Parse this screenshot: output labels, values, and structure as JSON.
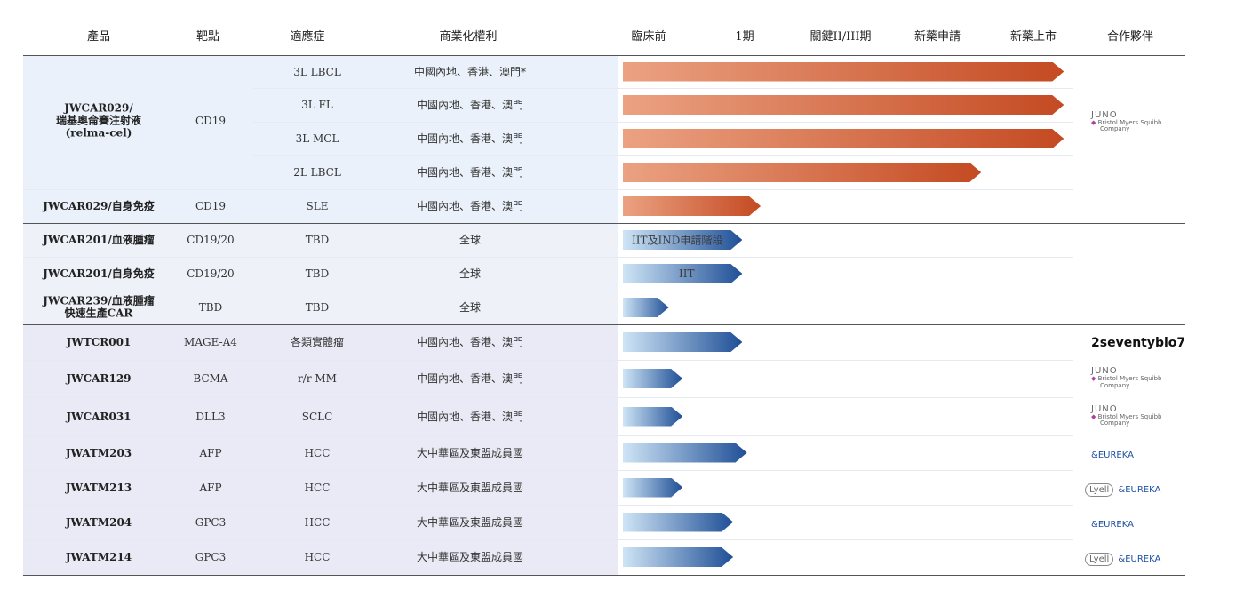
{
  "headers": {
    "product": "產品",
    "target": "靶點",
    "indication": "適應症",
    "rights": "商業化權利",
    "preclinical": "臨床前",
    "phase1": "1期",
    "pivotal": "關鍵II/III期",
    "nda": "新藥申請",
    "launch": "新藥上市",
    "partner": "合作夥伴"
  },
  "groups": [
    {
      "product": "JWCAR029/\n瑞基奧侖賽注射液\n(relma-cel)",
      "target": "CD19"
    }
  ],
  "rows": [
    {
      "product": "",
      "target": "",
      "indication": "3L LBCL",
      "rights": "中國內地、香港、澳門*"
    },
    {
      "product": "",
      "target": "",
      "indication": "3L FL",
      "rights": "中國內地、香港、澳門"
    },
    {
      "product": "",
      "target": "",
      "indication": "3L MCL",
      "rights": "中國內地、香港、澳門"
    },
    {
      "product": "",
      "target": "",
      "indication": "2L LBCL",
      "rights": "中國內地、香港、澳門"
    },
    {
      "product": "JWCAR029/自身免疫",
      "target": "CD19",
      "indication": "SLE",
      "rights": "中國內地、香港、澳門"
    },
    {
      "product": "JWCAR201/血液腫瘤",
      "target": "CD19/20",
      "indication": "TBD",
      "rights": "全球"
    },
    {
      "product": "JWCAR201/自身免疫",
      "target": "CD19/20",
      "indication": "TBD",
      "rights": "全球"
    },
    {
      "product": "JWCAR239/血液腫瘤\n快速生產CAR",
      "target": "TBD",
      "indication": "TBD",
      "rights": "全球"
    },
    {
      "product": "JWTCR001",
      "target": "MAGE-A4",
      "indication": "各類實體瘤",
      "rights": "中國內地、香港、澳門"
    },
    {
      "product": "JWCAR129",
      "target": "BCMA",
      "indication": "r/r MM",
      "rights": "中國內地、香港、澳門"
    },
    {
      "product": "JWCAR031",
      "target": "DLL3",
      "indication": "SCLC",
      "rights": "中國內地、香港、澳門"
    },
    {
      "product": "JWATM203",
      "target": "AFP",
      "indication": "HCC",
      "rights": "大中華區及東盟成員國"
    },
    {
      "product": "JWATM213",
      "target": "AFP",
      "indication": "HCC",
      "rights": "大中華區及東盟成員國"
    },
    {
      "product": "JWATM204",
      "target": "GPC3",
      "indication": "HCC",
      "rights": "大中華區及東盟成員國"
    },
    {
      "product": "JWATM214",
      "target": "GPC3",
      "indication": "HCC",
      "rights": "大中華區及東盟成員國"
    }
  ],
  "chart_data": {
    "type": "bar",
    "orientation": "horizontal",
    "stages": [
      "臨床前",
      "1期",
      "關鍵II/III期",
      "新藥申請",
      "新藥上市"
    ],
    "progress_unit": "stage columns reached (0 = start of 臨床前, 5 = end of 新藥上市)",
    "bars": [
      {
        "indication": "3L LBCL",
        "progress": 4.8,
        "color": "orange",
        "label": ""
      },
      {
        "indication": "3L FL",
        "progress": 4.8,
        "color": "orange",
        "label": ""
      },
      {
        "indication": "3L MCL",
        "progress": 4.8,
        "color": "orange",
        "label": ""
      },
      {
        "indication": "2L LBCL",
        "progress": 3.9,
        "color": "orange",
        "label": ""
      },
      {
        "indication": "SLE",
        "progress": 1.5,
        "color": "orange",
        "label": ""
      },
      {
        "indication": "TBD",
        "progress": 1.3,
        "color": "blue",
        "label": "IIT及IND申請階段"
      },
      {
        "indication": "TBD",
        "progress": 1.3,
        "color": "blue",
        "label": "IIT"
      },
      {
        "indication": "TBD",
        "progress": 0.5,
        "color": "blue",
        "label": ""
      },
      {
        "indication": "各類實體瘤",
        "progress": 1.3,
        "color": "blue",
        "label": ""
      },
      {
        "indication": "r/r MM",
        "progress": 0.65,
        "color": "blue",
        "label": ""
      },
      {
        "indication": "SCLC",
        "progress": 0.65,
        "color": "blue",
        "label": ""
      },
      {
        "indication": "HCC",
        "progress": 1.35,
        "color": "blue",
        "label": ""
      },
      {
        "indication": "HCC",
        "progress": 0.65,
        "color": "blue",
        "label": ""
      },
      {
        "indication": "HCC",
        "progress": 1.2,
        "color": "blue",
        "label": ""
      },
      {
        "indication": "HCC",
        "progress": 1.2,
        "color": "blue",
        "label": ""
      }
    ]
  },
  "partners": [
    {
      "rows": [
        0,
        3
      ],
      "kind": "juno-bms",
      "juno": "JUNO",
      "bms": "Bristol Myers Squibb",
      "bms_sub": "Company"
    },
    {
      "rows": [
        8
      ],
      "kind": "2seventy",
      "text": "2seventybio",
      "sup": "7"
    },
    {
      "rows": [
        9
      ],
      "kind": "juno-bms",
      "juno": "JUNO",
      "bms": "Bristol Myers Squibb",
      "bms_sub": "Company"
    },
    {
      "rows": [
        10
      ],
      "kind": "juno-bms",
      "juno": "JUNO",
      "bms": "Bristol Myers Squibb",
      "bms_sub": "Company"
    },
    {
      "rows": [
        11
      ],
      "kind": "eureka",
      "text": "EUREKA"
    },
    {
      "rows": [
        12
      ],
      "kind": "lyell-eureka",
      "lyell": "Lyell",
      "text": "EUREKA"
    },
    {
      "rows": [
        13
      ],
      "kind": "eureka",
      "text": "EUREKA"
    },
    {
      "rows": [
        14
      ],
      "kind": "lyell-eureka",
      "lyell": "Lyell",
      "text": "EUREKA"
    }
  ],
  "colors": {
    "orange_start": "#eba282",
    "orange_end": "#c44a22",
    "blue_start": "#cfe5f6",
    "blue_end": "#1f4f96",
    "section1_bg": "#eaf1fa",
    "section2_bg": "#eef1f8",
    "section3_bg": "#e9eaf5"
  }
}
